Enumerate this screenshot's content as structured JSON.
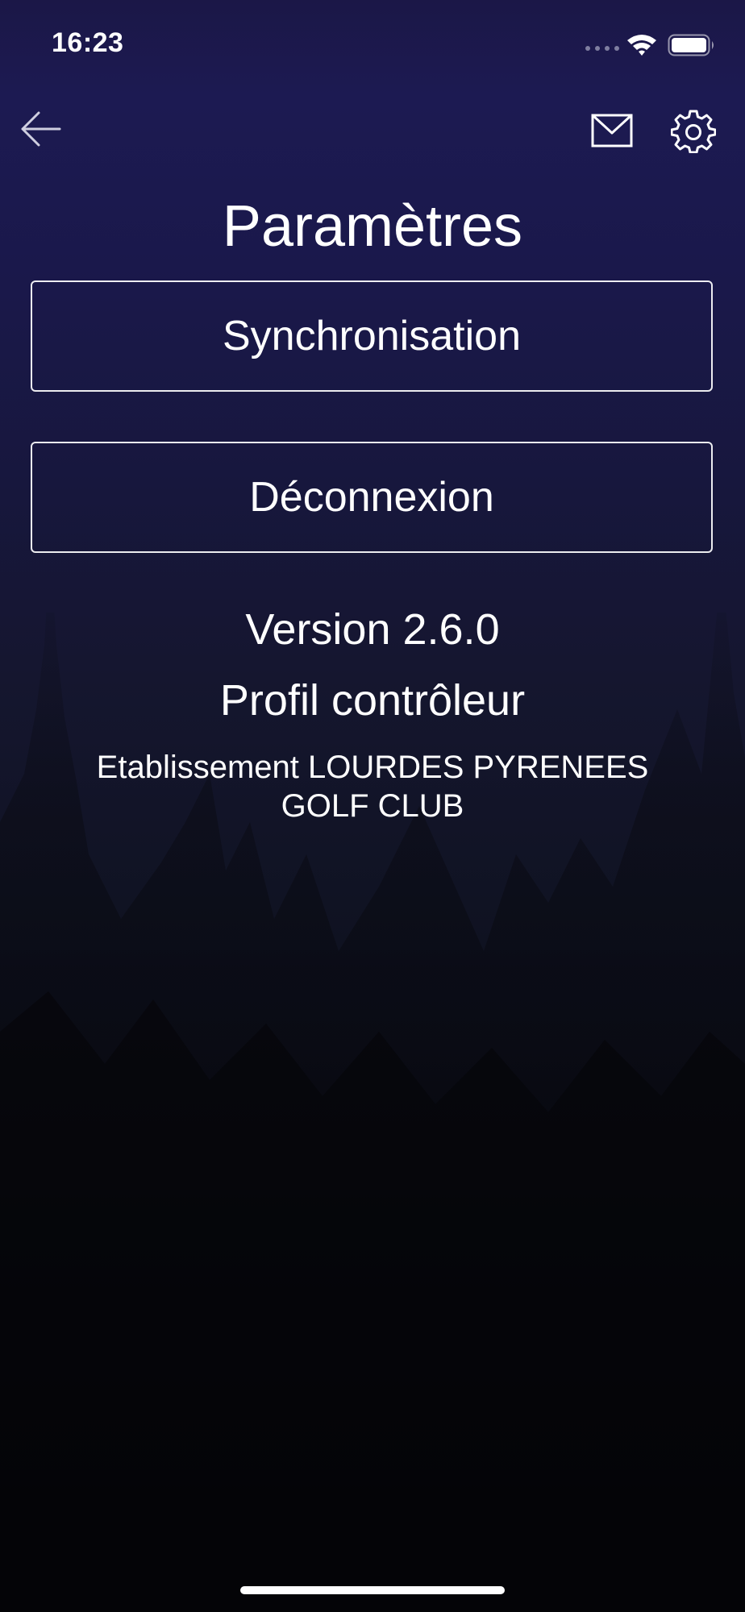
{
  "status_bar": {
    "time": "16:23"
  },
  "nav": {
    "back_icon": "arrow-left-icon",
    "mail_icon": "envelope-icon",
    "settings_icon": "gear-icon"
  },
  "page": {
    "title": "Paramètres"
  },
  "buttons": {
    "sync_label": "Synchronisation",
    "logout_label": "Déconnexion"
  },
  "info": {
    "version": "Version 2.6.0",
    "profile": "Profil contrôleur",
    "establishment": "Etablissement LOURDES PYRENEES GOLF CLUB"
  },
  "colors": {
    "background_top": "#1c1a52",
    "background_bottom": "#020203",
    "foreground": "#ffffff"
  }
}
